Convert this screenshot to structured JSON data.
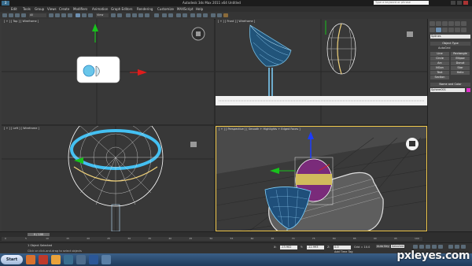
{
  "app": {
    "logo": "3",
    "title": "Autodesk 3ds Max 2011 x64    Untitled",
    "search_placeholder": "Type a keyword or phrase"
  },
  "menu": [
    "Edit",
    "Tools",
    "Group",
    "Views",
    "Create",
    "Modifiers",
    "Animation",
    "Graph Editors",
    "Rendering",
    "Customize",
    "MAXScript",
    "Help"
  ],
  "toolbar": {
    "selection_filter": "All",
    "view_dropdown": "View"
  },
  "viewports": {
    "top": {
      "label": "[ + ] [ Top ] [ Wireframe ]"
    },
    "front": {
      "label": "[ + ] [ Front ] [ Wireframe ]"
    },
    "left": {
      "label": "[ + ] [ Left ] [ Wireframe ]"
    },
    "perspective": {
      "label": "[ + ] [ Perspective ] [ Smooth + Highlights + Edged Faces ]"
    }
  },
  "command_panel": {
    "category": "Splines",
    "rollout_object_type": "Object Type",
    "autogrid": "AutoGrid",
    "buttons": [
      "Line",
      "Rectangle",
      "Circle",
      "Ellipse",
      "Arc",
      "Donut",
      "NGon",
      "Star",
      "Text",
      "Helix",
      "Section"
    ],
    "rollout_name_color": "Name and Color",
    "object_name": "Sphere001",
    "object_color": "#e030c9"
  },
  "timeline": {
    "frame_slider": "0 / 100",
    "ticks": [
      "0",
      "5",
      "10",
      "15",
      "20",
      "25",
      "30",
      "35",
      "40",
      "45",
      "50",
      "55",
      "60",
      "65",
      "70",
      "75",
      "80",
      "85",
      "90",
      "95",
      "100"
    ]
  },
  "status": {
    "selection": "1 Object Selected",
    "prompt": "Click or click-and-drag to select objects",
    "x_label": "X:",
    "x_value": "-13.902",
    "y_label": "Y:",
    "y_value": "-12.993",
    "z_label": "Z:",
    "z_value": "0.0",
    "grid": "Grid = 10.0",
    "auto_key": "Auto Key",
    "selected": "Selected",
    "add_time_tag": "Add Time Tag"
  },
  "taskbar": {
    "start": "Start"
  },
  "watermark": "pxleyes.com"
}
